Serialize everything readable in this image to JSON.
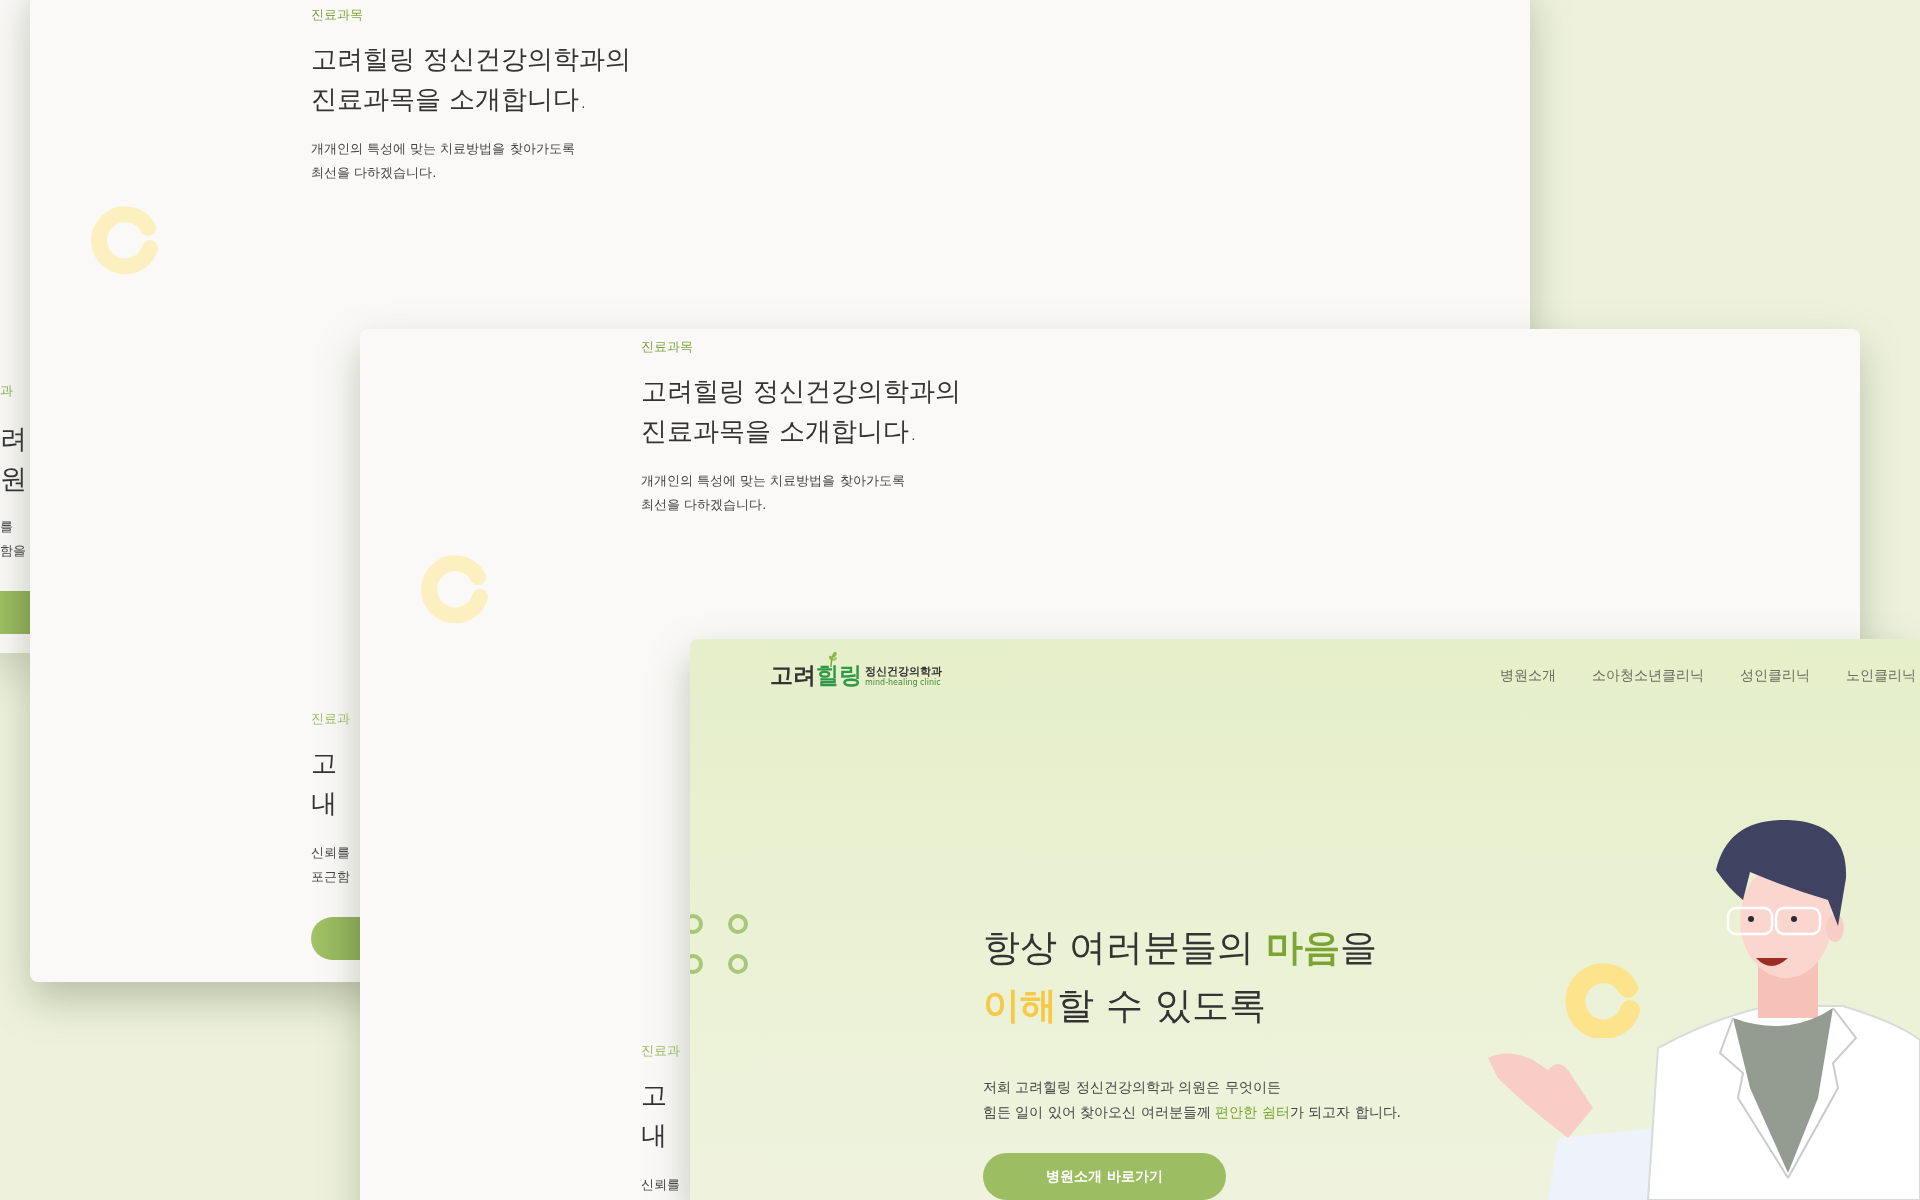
{
  "back_screen": {
    "section_label": "과",
    "title_lines": [
      "려",
      "원"
    ],
    "text_lines": [
      "를",
      "함을"
    ]
  },
  "intro_screens": [
    {
      "section_label": "진료과목",
      "title_lines": [
        "고려힐링 정신건강의학과의",
        "진료과목을 소개합니다."
      ],
      "text_lines": [
        "개개인의 특성에 맞는 치료방법을 찾아가도록",
        "최선을 다하겠습니다."
      ],
      "next_section": {
        "label": "진료과",
        "title_lines": [
          "고",
          "내"
        ],
        "text_lines": [
          "신뢰를",
          "포근함"
        ],
        "has_button": true
      }
    },
    {
      "section_label": "진료과목",
      "title_lines": [
        "고려힐링 정신건강의학과의",
        "진료과목을 소개합니다."
      ],
      "text_lines": [
        "개개인의 특성에 맞는 치료방법을 찾아가도록",
        "최선을 다하겠습니다."
      ],
      "next_section": {
        "label": "진료과",
        "title_lines": [
          "고",
          "내"
        ],
        "text_lines": [
          "신뢰를"
        ],
        "has_button": false
      }
    }
  ],
  "front_screen": {
    "logo": {
      "name": "고려**힐링**",
      "subtitle": "정신건강의학과",
      "english": "mind-healing clinic"
    },
    "nav": [
      "병원소개",
      "소아청소년클리닉",
      "성인클리닉",
      "노인클리닉"
    ],
    "hero": {
      "title_lines": [
        "항상 여러분들의 **마음**을",
        "**이해**할 수 있도록"
      ],
      "text_lines": [
        "저희 고려힐링 정신건강의학과 의원은 무엇이든",
        "힘든 일이 있어 찾아오신 여러분들께 **편안한 쉼터**가 되고자 합니다."
      ],
      "button": "병원소개 바로가기"
    }
  }
}
